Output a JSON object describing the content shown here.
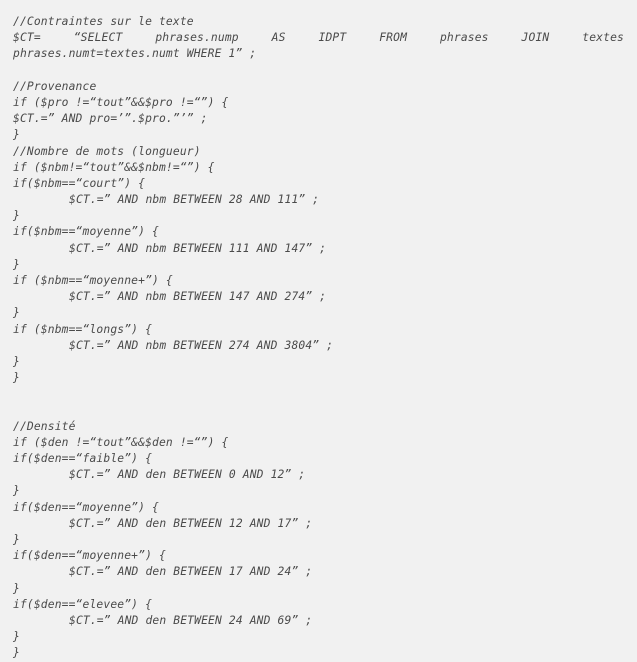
{
  "document": {
    "type": "code-listing",
    "language": "php",
    "background_color": "#f1f1f1",
    "text_color": "#4a4a4a",
    "font_style": "italic-monospace"
  },
  "code": {
    "sections": [
      {
        "name": "contraintes-sur-le-texte",
        "comment": "//Contraintes sur le texte"
      },
      {
        "name": "provenance",
        "comment": "//Provenance"
      },
      {
        "name": "nombre-de-mots",
        "comment": "//Nombre de mots (longueur)"
      },
      {
        "name": "densite",
        "comment": "//Densité"
      }
    ],
    "lines": [
      {
        "id": "l1",
        "text": "//Contraintes sur le texte",
        "kind": "comment",
        "indent": 0
      },
      {
        "id": "l2a",
        "text": "$CT=   “SELECT   phrases.nump   AS   IDPT   FROM   phrases   JOIN   textes",
        "kind": "statement",
        "indent": 0,
        "justified": true
      },
      {
        "id": "l2b",
        "text": "phrases.numt=textes.numt WHERE 1” ;",
        "kind": "statement",
        "indent": 0
      },
      {
        "id": "l3",
        "text": "",
        "kind": "blank",
        "indent": 0
      },
      {
        "id": "l4",
        "text": "//Provenance",
        "kind": "comment",
        "indent": 0
      },
      {
        "id": "l5",
        "text": "if ($pro !=“tout”&&$pro !=“”) {",
        "kind": "statement",
        "indent": 0
      },
      {
        "id": "l6",
        "text": "$CT.=” AND pro=’”.$pro.”’” ;",
        "kind": "statement",
        "indent": 0
      },
      {
        "id": "l7",
        "text": "}",
        "kind": "brace",
        "indent": 0
      },
      {
        "id": "l8",
        "text": "//Nombre de mots (longueur)",
        "kind": "comment",
        "indent": 0
      },
      {
        "id": "l9",
        "text": "if ($nbm!=“tout”&&$nbm!=“”) {",
        "kind": "statement",
        "indent": 0
      },
      {
        "id": "l10",
        "text": "if($nbm==“court”) {",
        "kind": "statement",
        "indent": 0
      },
      {
        "id": "l11",
        "text": "$CT.=” AND nbm BETWEEN 28 AND 111” ;",
        "kind": "statement",
        "indent": 1
      },
      {
        "id": "l12",
        "text": "}",
        "kind": "brace",
        "indent": 0
      },
      {
        "id": "l13",
        "text": "if($nbm==“moyenne”) {",
        "kind": "statement",
        "indent": 0
      },
      {
        "id": "l14",
        "text": "$CT.=” AND nbm BETWEEN 111 AND 147” ;",
        "kind": "statement",
        "indent": 1
      },
      {
        "id": "l15",
        "text": "}",
        "kind": "brace",
        "indent": 0
      },
      {
        "id": "l16",
        "text": "if ($nbm==“moyenne+”) {",
        "kind": "statement",
        "indent": 0
      },
      {
        "id": "l17",
        "text": "$CT.=” AND nbm BETWEEN 147 AND 274” ;",
        "kind": "statement",
        "indent": 1
      },
      {
        "id": "l18",
        "text": "}",
        "kind": "brace",
        "indent": 0
      },
      {
        "id": "l19",
        "text": "if ($nbm==“longs”) {",
        "kind": "statement",
        "indent": 0
      },
      {
        "id": "l20",
        "text": "$CT.=” AND nbm BETWEEN 274 AND 3804” ;",
        "kind": "statement",
        "indent": 1
      },
      {
        "id": "l21",
        "text": "}",
        "kind": "brace",
        "indent": 0
      },
      {
        "id": "l22",
        "text": "}",
        "kind": "brace",
        "indent": 0
      },
      {
        "id": "l23",
        "text": "",
        "kind": "blank",
        "indent": 0
      },
      {
        "id": "l24",
        "text": "",
        "kind": "blank",
        "indent": 0
      },
      {
        "id": "l25",
        "text": "//Densité",
        "kind": "comment",
        "indent": 0
      },
      {
        "id": "l26",
        "text": "if ($den !=“tout”&&$den !=“”) {",
        "kind": "statement",
        "indent": 0
      },
      {
        "id": "l27",
        "text": "if($den==“faible”) {",
        "kind": "statement",
        "indent": 0
      },
      {
        "id": "l28",
        "text": "$CT.=” AND den BETWEEN 0 AND 12” ;",
        "kind": "statement",
        "indent": 1
      },
      {
        "id": "l29",
        "text": "}",
        "kind": "brace",
        "indent": 0
      },
      {
        "id": "l30",
        "text": "if($den==“moyenne”) {",
        "kind": "statement",
        "indent": 0
      },
      {
        "id": "l31",
        "text": "$CT.=” AND den BETWEEN 12 AND 17” ;",
        "kind": "statement",
        "indent": 1
      },
      {
        "id": "l32",
        "text": "}",
        "kind": "brace",
        "indent": 0
      },
      {
        "id": "l33",
        "text": "if($den==“moyenne+”) {",
        "kind": "statement",
        "indent": 0
      },
      {
        "id": "l34",
        "text": "$CT.=” AND den BETWEEN 17 AND 24” ;",
        "kind": "statement",
        "indent": 1
      },
      {
        "id": "l35",
        "text": "}",
        "kind": "brace",
        "indent": 0
      },
      {
        "id": "l36",
        "text": "if($den==“elevee”) {",
        "kind": "statement",
        "indent": 0
      },
      {
        "id": "l37",
        "text": "$CT.=” AND den BETWEEN 24 AND 69” ;",
        "kind": "statement",
        "indent": 1
      },
      {
        "id": "l38",
        "text": "}",
        "kind": "brace",
        "indent": 0
      },
      {
        "id": "l39",
        "text": "}",
        "kind": "brace",
        "indent": 0
      }
    ]
  }
}
